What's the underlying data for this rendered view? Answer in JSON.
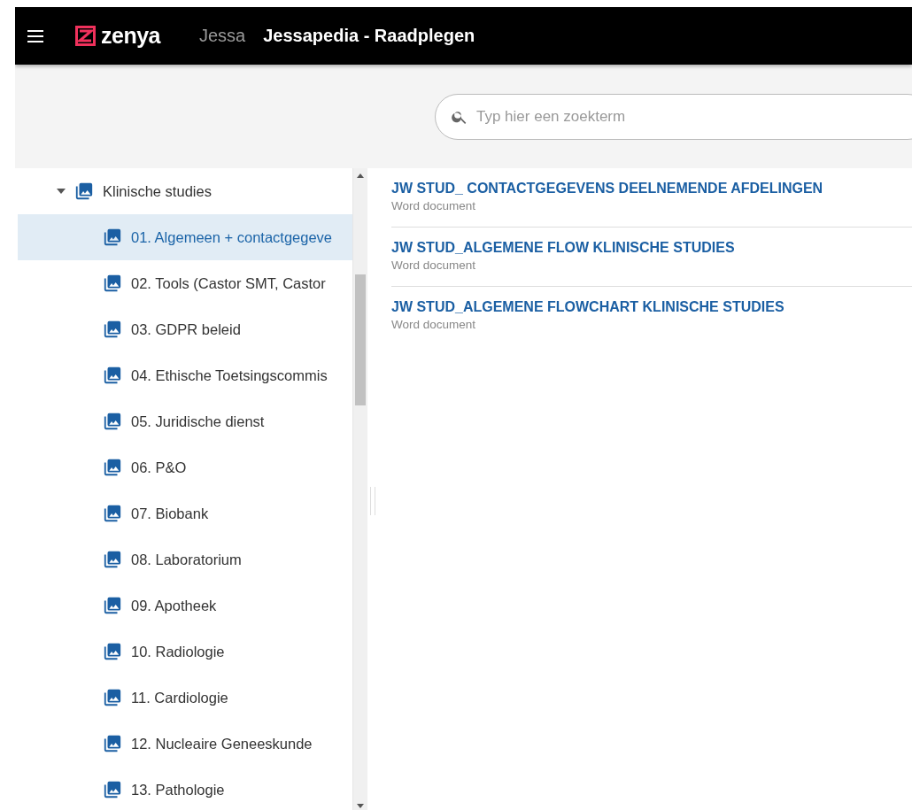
{
  "header": {
    "brand": "zenya",
    "org": "Jessa",
    "title": "Jessapedia - Raadplegen"
  },
  "search": {
    "placeholder": "Typ hier een zoekterm"
  },
  "tree": [
    {
      "label": "Klinische studies",
      "expanded": true,
      "selected": false,
      "children": [
        {
          "label": "01. Algemeen + contactgegeve",
          "selected": true
        },
        {
          "label": "02. Tools (Castor SMT, Castor",
          "selected": false
        },
        {
          "label": "03. GDPR beleid",
          "selected": false
        },
        {
          "label": "04. Ethische Toetsingscommis",
          "selected": false
        },
        {
          "label": "05. Juridische dienst",
          "selected": false
        },
        {
          "label": "06. P&O",
          "selected": false
        },
        {
          "label": "07. Biobank",
          "selected": false
        },
        {
          "label": "08. Laboratorium",
          "selected": false
        },
        {
          "label": "09. Apotheek",
          "selected": false
        },
        {
          "label": "10. Radiologie",
          "selected": false
        },
        {
          "label": "11. Cardiologie",
          "selected": false
        },
        {
          "label": "12. Nucleaire Geneeskunde",
          "selected": false
        },
        {
          "label": "13. Pathologie",
          "selected": false
        }
      ]
    }
  ],
  "documents": [
    {
      "title": "JW STUD_ CONTACTGEGEVENS DEELNEMENDE AFDELINGEN",
      "type": "Word document"
    },
    {
      "title": "JW STUD_ALGEMENE FLOW KLINISCHE STUDIES",
      "type": "Word document"
    },
    {
      "title": "JW STUD_ALGEMENE FLOWCHART KLINISCHE STUDIES",
      "type": "Word document"
    }
  ]
}
